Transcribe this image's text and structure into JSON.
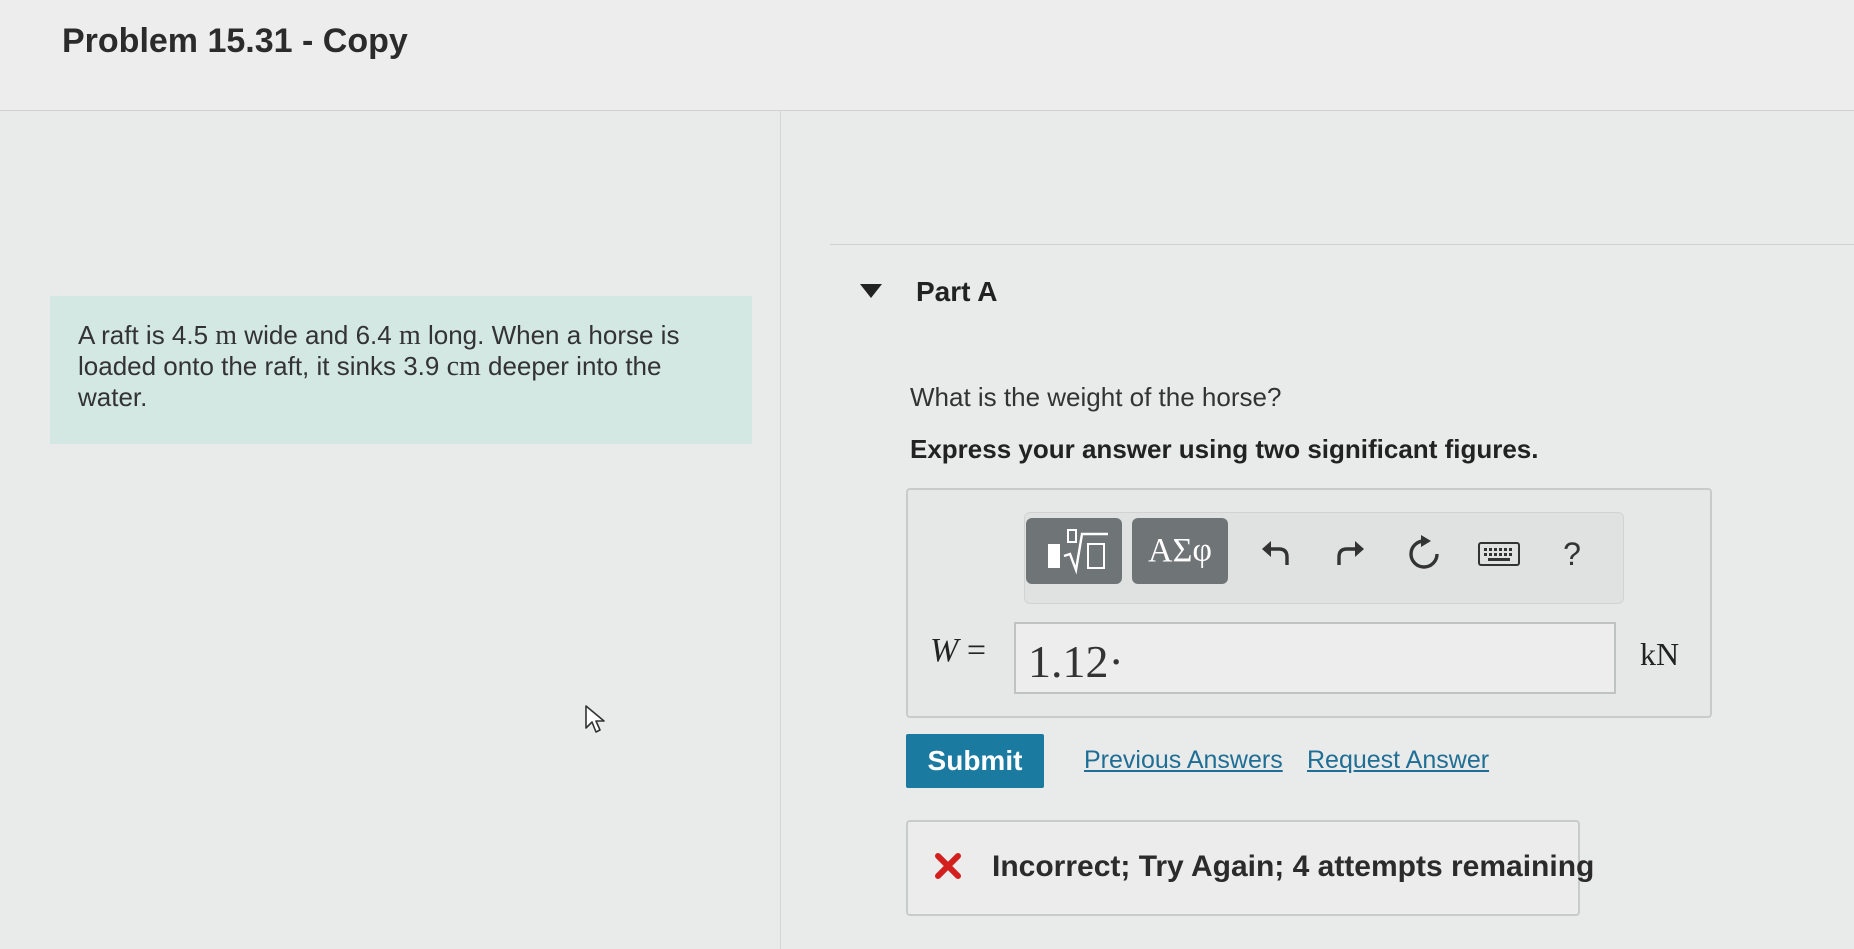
{
  "page": {
    "title": "Problem 15.31 - Copy"
  },
  "problem": {
    "line1_a": "A raft is 4.5 ",
    "unit_m": "m",
    "line1_b": " wide and 6.4 ",
    "line1_c": " long. When a horse is",
    "line2_a": "loaded onto the raft, it sinks 3.9 ",
    "unit_cm": "cm",
    "line2_b": " deeper into the",
    "line3": "water."
  },
  "part": {
    "label": "Part A",
    "question": "What is the weight of the horse?",
    "instruction": "Express your answer using two significant figures."
  },
  "toolbar": {
    "templates_icon": "templates-sqrt-icon",
    "greek_label": "ΑΣφ",
    "undo_icon": "undo-icon",
    "redo_icon": "redo-icon",
    "reset_icon": "reset-icon",
    "keyboard_icon": "keyboard-icon",
    "help_label": "?"
  },
  "answer": {
    "variable": "W",
    "equals": "=",
    "value": "1.12·",
    "unit": "kN"
  },
  "actions": {
    "submit_label": "Submit",
    "previous_answers_label": "Previous Answers",
    "request_answer_label": "Request Answer"
  },
  "feedback": {
    "icon": "x-mark-icon",
    "text": "Incorrect; Try Again; 4 attempts remaining",
    "color": "#d3201f"
  }
}
